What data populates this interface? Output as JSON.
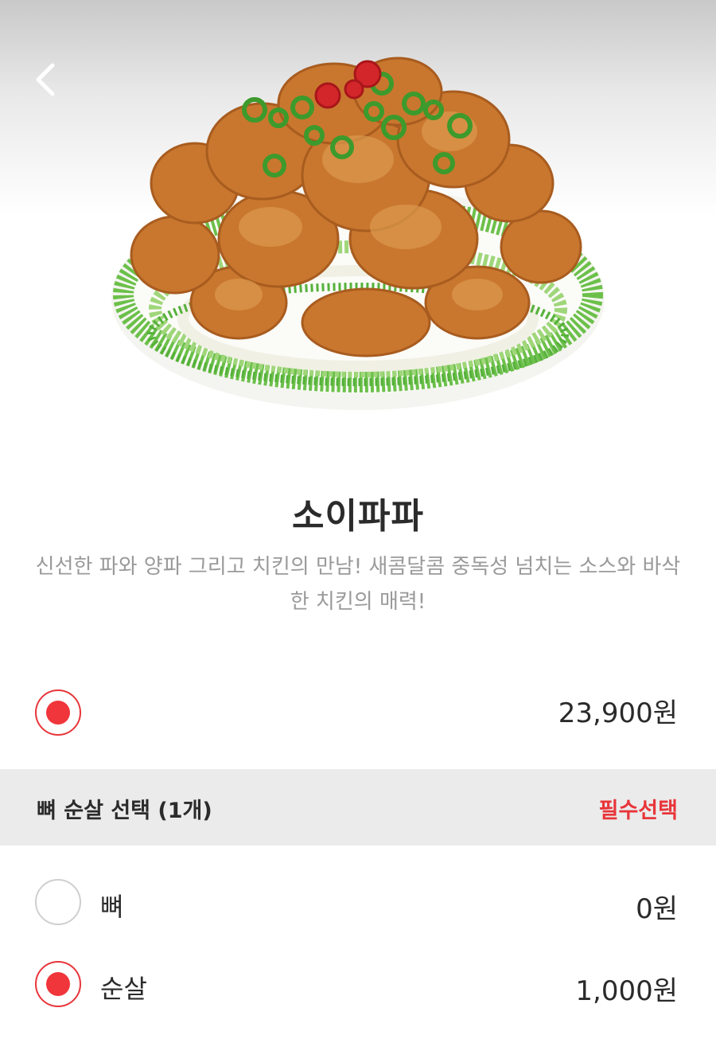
{
  "header": {
    "back_icon": "chevron-left-icon"
  },
  "product": {
    "image_icon": "fried-chicken-plate-image",
    "name": "소이파파",
    "description": "신선한 파와 양파 그리고 치킨의 만남! 새콤달콤 중독성 넘치는 소스와 바삭한 치킨의 매력!",
    "price": "23,900원",
    "price_selected": true
  },
  "option_group": {
    "title": "뼈 순살 선택 (1개)",
    "badge": "필수선택",
    "badge_color": "#e8353a",
    "options": [
      {
        "label": "뼈",
        "price": "0원",
        "selected": false
      },
      {
        "label": "순살",
        "price": "1,000원",
        "selected": true
      }
    ]
  },
  "colors": {
    "accent": "#f0363b",
    "section_bg": "#ebebeb",
    "desc_text": "#9a9a9a"
  }
}
